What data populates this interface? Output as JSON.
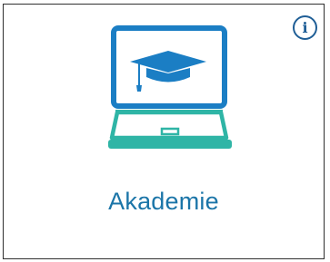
{
  "tile": {
    "label": "Akademie"
  },
  "info_button": {
    "glyph": "i",
    "icon": "info-icon"
  },
  "illustration": {
    "icon": "laptop-graduation-cap-icon",
    "colors": {
      "screen_frame": "#1b7ec4",
      "cap": "#1b7ec4",
      "base": "#2fb5a6"
    }
  },
  "colors": {
    "label": "#1b75a8",
    "info": "#1f5e96",
    "border": "#2f2f2f"
  }
}
